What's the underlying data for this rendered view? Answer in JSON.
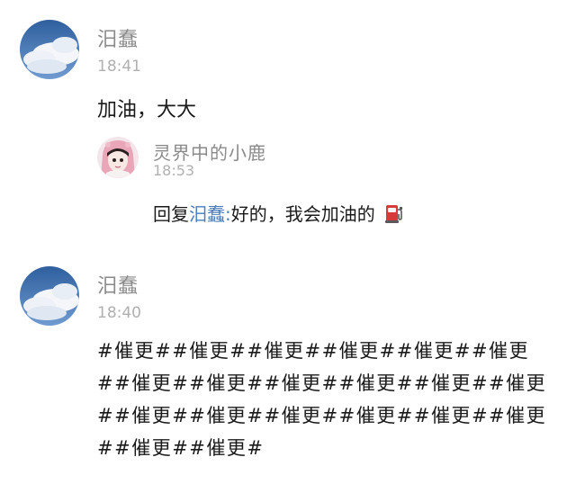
{
  "comments": [
    {
      "username": "汨蠢",
      "time": "18:41",
      "content": "加油，大大",
      "reply": {
        "username": "灵界中的小鹿",
        "time": "18:53",
        "prefix": "回复",
        "mention": "汨蠢",
        "separator": ":",
        "text": "好的，我会加油的"
      }
    },
    {
      "username": "汨蠢",
      "time": "18:40",
      "lines": [
        "#催更##催更##催更##催更##催更##催更",
        "##催更##催更##催更##催更##催更##催更",
        "##催更##催更##催更##催更##催更##催更",
        "##催更##催更#"
      ]
    }
  ]
}
